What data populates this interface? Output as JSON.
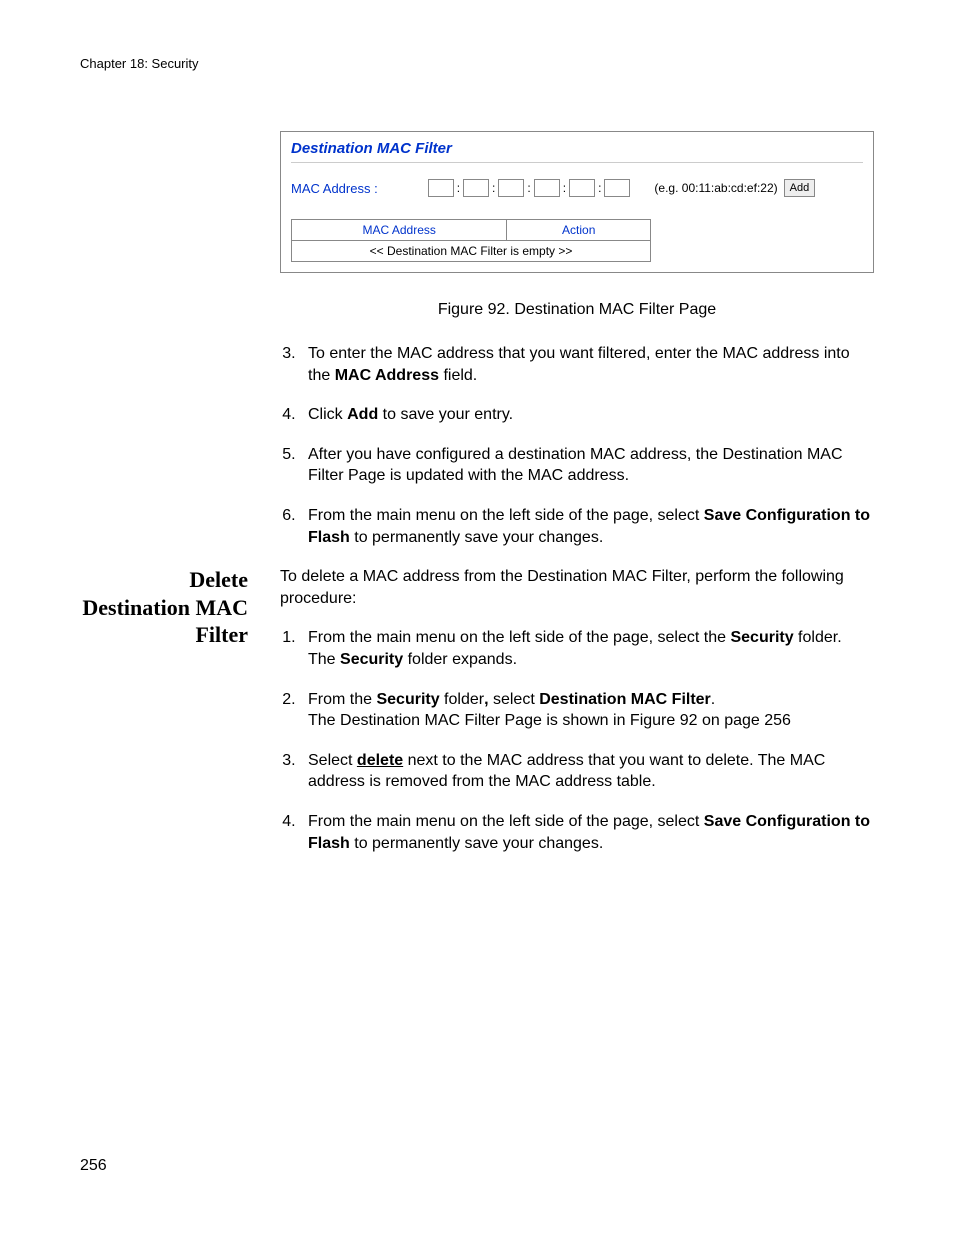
{
  "header": "Chapter 18: Security",
  "figure": {
    "title": "Destination MAC Filter",
    "mac_label": "MAC Address :",
    "example": "(e.g. 00:11:ab:cd:ef:22)",
    "add_button": "Add",
    "table": {
      "col1": "MAC Address",
      "col2": "Action",
      "empty": "<< Destination MAC Filter is empty >>"
    },
    "caption": "Figure 92. Destination MAC Filter Page"
  },
  "steps_a": {
    "s3_a": "To enter the MAC address that you want filtered, enter the MAC address into the ",
    "s3_b": "MAC Address",
    "s3_c": " field.",
    "s4_a": "Click ",
    "s4_b": "Add",
    "s4_c": " to save your entry.",
    "s5": "After you have configured a destination MAC address, the Destination MAC Filter Page is updated with the MAC address.",
    "s6_a": "From the main menu on the left side of the page, select ",
    "s6_b": "Save Configuration to Flash",
    "s6_c": " to permanently save your changes."
  },
  "section2": {
    "heading": "Delete Destination MAC Filter",
    "intro": "To delete a MAC address from the Destination MAC Filter, perform the following procedure:",
    "s1_a": "From the main menu on the left side of the page, select the ",
    "s1_b": "Security",
    "s1_c": " folder.",
    "s1_d": "The ",
    "s1_e": "Security",
    "s1_f": " folder expands.",
    "s2_a": "From the ",
    "s2_b": "Security",
    "s2_c": " folder",
    "s2_comma": ",",
    "s2_d": " select ",
    "s2_e": "Destination MAC Filter",
    "s2_f": ".",
    "s2_g": "The Destination MAC Filter Page is shown in Figure 92 on page 256",
    "s3_a": "Select ",
    "s3_b": "delete",
    "s3_c": " next to the MAC address that you want to delete. The MAC address is removed from the MAC address table.",
    "s4_a": "From the main menu on the left side of the page, select ",
    "s4_b": "Save Configuration to Flash",
    "s4_c": " to permanently save your changes."
  },
  "page_number": "256"
}
